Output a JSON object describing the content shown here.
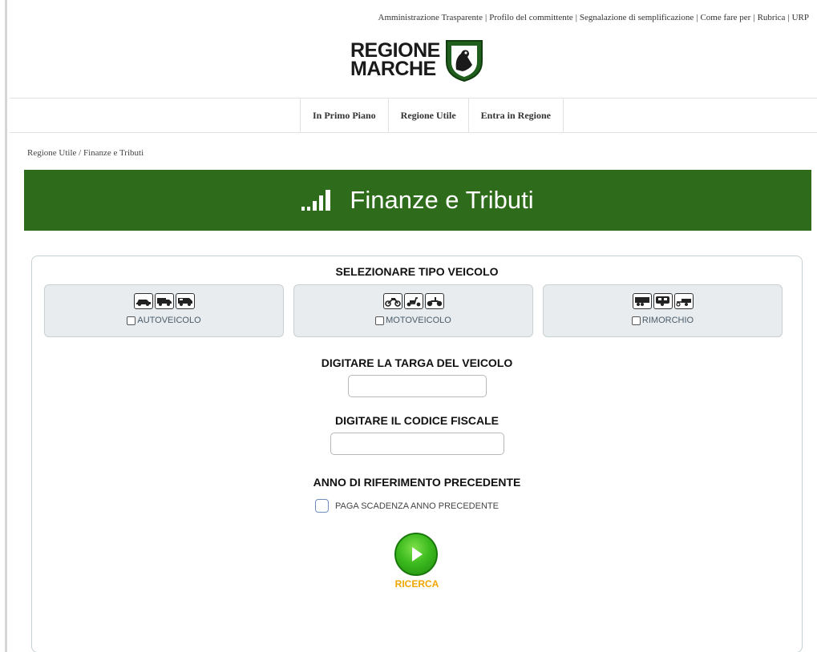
{
  "utility_links": [
    "Amministrazione Trasparente",
    "Profilo del committente",
    "Segnalazione di semplificazione",
    "Come fare per",
    "Rubrica",
    "URP"
  ],
  "logo": {
    "line1": "REGIONE",
    "line2": "MARCHE"
  },
  "nav": {
    "items": [
      "In Primo Piano",
      "Regione Utile",
      "Entra in Regione"
    ]
  },
  "breadcrumb": "Regione Utile / Finanze e Tributi",
  "banner": {
    "title": "Finanze e Tributi",
    "icon": "signal-bars-icon",
    "color": "#2e6b1b"
  },
  "form": {
    "vehicle_section_title": "SELEZIONARE TIPO VEICOLO",
    "vehicle_types": [
      {
        "label": "AUTOVEICOLO",
        "icons": [
          "car-icon",
          "truck-icon",
          "van-icon"
        ],
        "checked": false
      },
      {
        "label": "MOTOVEICOLO",
        "icons": [
          "motorbike-icon",
          "scooter-icon",
          "quad-icon"
        ],
        "checked": false
      },
      {
        "label": "RIMORCHIO",
        "icons": [
          "trailer-icon",
          "caravan-icon",
          "small-trailer-icon"
        ],
        "checked": false
      }
    ],
    "plate_label": "DIGITARE LA TARGA DEL VEICOLO",
    "plate_value": "",
    "tax_code_label": "DIGITARE IL CODICE FISCALE",
    "tax_code_value": "",
    "prev_year_title": "ANNO DI RIFERIMENTO PRECEDENTE",
    "prev_year_checkbox_label": "PAGA SCADENZA ANNO PRECEDENTE",
    "prev_year_checked": false,
    "search_label": "RICERCA",
    "search_color": "#f0a500"
  }
}
